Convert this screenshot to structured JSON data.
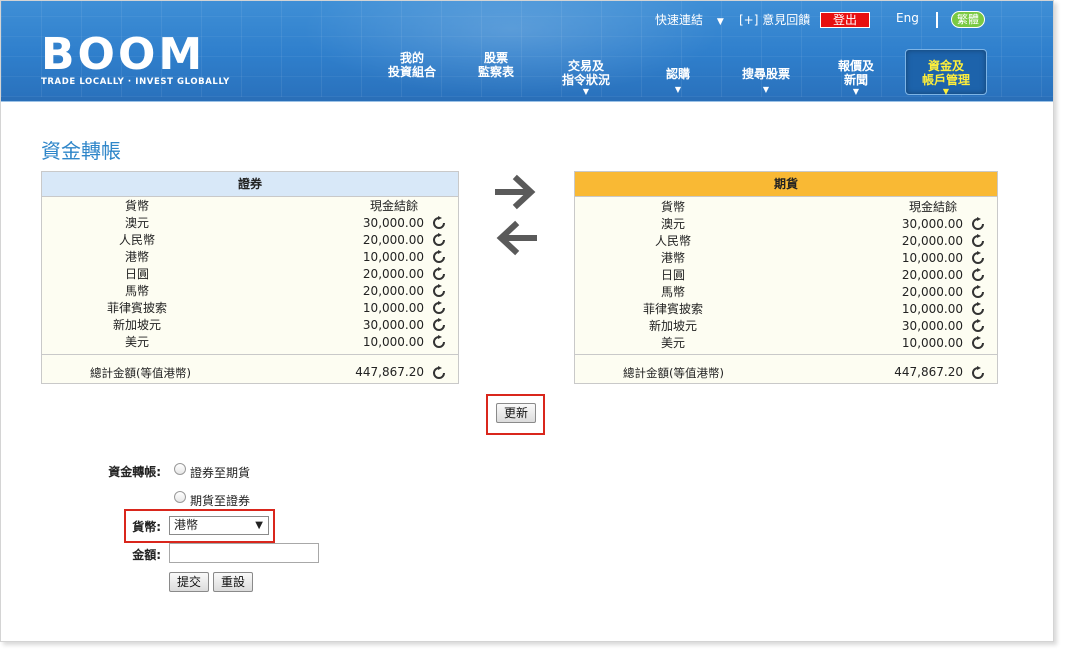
{
  "header": {
    "logo_main": "BOOM",
    "logo_tagline": "TRADE LOCALLY · INVEST GLOBALLY",
    "quick_links": "快速連結",
    "quick_links_caret": "▼",
    "feedback": "[+] 意見回饋",
    "logout": "登出",
    "lang_en": "Eng",
    "lang_tc": "繁體"
  },
  "nav": [
    {
      "line1": "我的",
      "line2": "投資組合",
      "caret": ""
    },
    {
      "line1": "股票",
      "line2": "監察表",
      "caret": ""
    },
    {
      "line1": "交易及",
      "line2": "指令狀況",
      "caret": "▼"
    },
    {
      "line1": "認購",
      "line2": "",
      "caret": "▼"
    },
    {
      "line1": "搜尋股票",
      "line2": "",
      "caret": "▼"
    },
    {
      "line1": "報價及",
      "line2": "新聞",
      "caret": "▼"
    },
    {
      "line1": "資金及",
      "line2": "帳戶管理",
      "caret": "▼"
    }
  ],
  "page_title": "資金轉帳",
  "securities": {
    "title": "證券",
    "col_currency": "貨幣",
    "col_balance": "現金結餘",
    "rows": [
      {
        "currency": "澳元",
        "amount": "30,000.00"
      },
      {
        "currency": "人民幣",
        "amount": "20,000.00"
      },
      {
        "currency": "港幣",
        "amount": "10,000.00"
      },
      {
        "currency": "日圓",
        "amount": "20,000.00"
      },
      {
        "currency": "馬幣",
        "amount": "20,000.00"
      },
      {
        "currency": "菲律賓披索",
        "amount": "10,000.00"
      },
      {
        "currency": "新加坡元",
        "amount": "30,000.00"
      },
      {
        "currency": "美元",
        "amount": "10,000.00"
      }
    ],
    "total_label": "總計金額(等值港幣)",
    "total_amount": "447,867.20"
  },
  "futures": {
    "title": "期貨",
    "col_currency": "貨幣",
    "col_balance": "現金結餘",
    "rows": [
      {
        "currency": "澳元",
        "amount": "30,000.00"
      },
      {
        "currency": "人民幣",
        "amount": "20,000.00"
      },
      {
        "currency": "港幣",
        "amount": "10,000.00"
      },
      {
        "currency": "日圓",
        "amount": "20,000.00"
      },
      {
        "currency": "馬幣",
        "amount": "20,000.00"
      },
      {
        "currency": "菲律賓披索",
        "amount": "10,000.00"
      },
      {
        "currency": "新加坡元",
        "amount": "30,000.00"
      },
      {
        "currency": "美元",
        "amount": "10,000.00"
      }
    ],
    "total_label": "總計金額(等值港幣)",
    "total_amount": "447,867.20"
  },
  "refresh_label": "更新",
  "form": {
    "transfer_label": "資金轉帳:",
    "option_sec_to_fut": "證券至期貨",
    "option_fut_to_sec": "期貨至證券",
    "currency_label": "貨幣:",
    "currency_value": "港幣",
    "amount_label": "金額:",
    "amount_value": "",
    "submit_label": "提交",
    "reset_label": "重設"
  },
  "colors": {
    "header_blue": "#2f7fcc",
    "title_blue": "#2f86c9",
    "futures_header": "#f9b934",
    "securities_header": "#d8e8f8",
    "highlight_red": "#d9261c",
    "active_nav_text": "#ffef3a"
  },
  "icons": [
    "refresh-icon",
    "arrow-right-icon",
    "arrow-left-icon",
    "chevron-down-icon"
  ]
}
